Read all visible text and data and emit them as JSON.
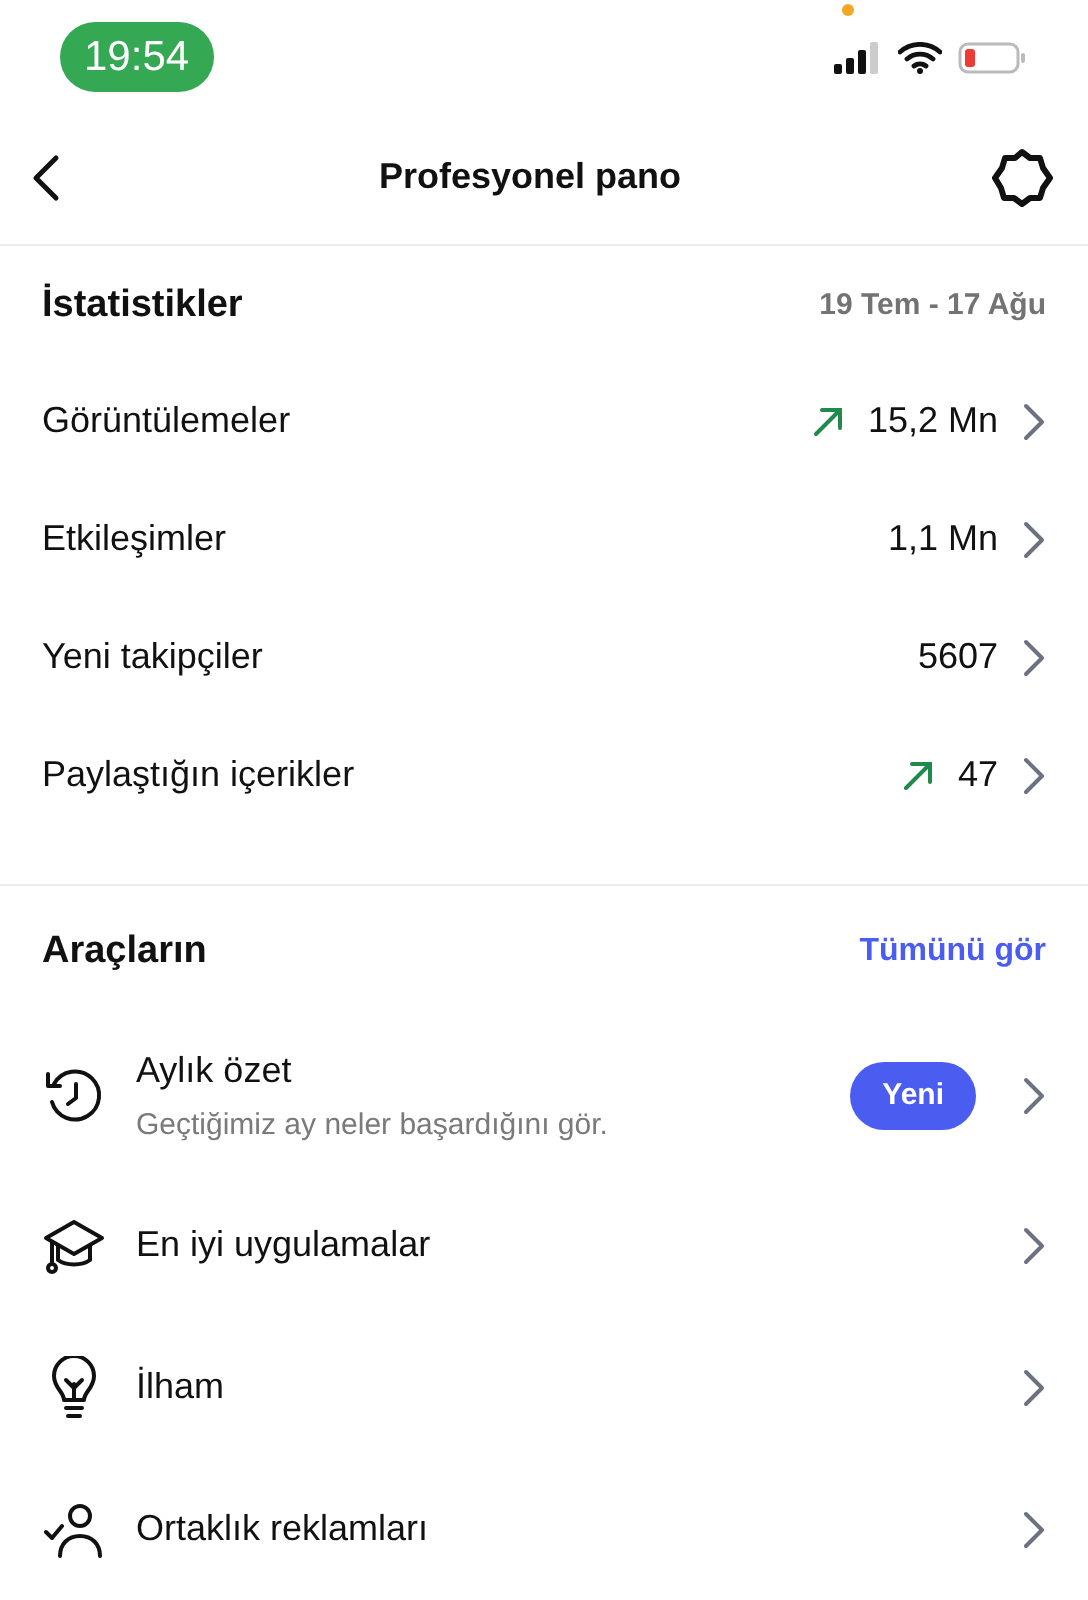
{
  "status_bar": {
    "time": "19:54"
  },
  "header": {
    "title": "Profesyonel pano"
  },
  "stats": {
    "title": "İstatistikler",
    "date_range": "19 Tem - 17 Ağu",
    "rows": [
      {
        "label": "Görüntülemeler",
        "value": "15,2 Mn",
        "trend_up": true
      },
      {
        "label": "Etkileşimler",
        "value": "1,1 Mn",
        "trend_up": false
      },
      {
        "label": "Yeni takipçiler",
        "value": "5607",
        "trend_up": false
      },
      {
        "label": "Paylaştığın içerikler",
        "value": "47",
        "trend_up": true
      }
    ]
  },
  "tools": {
    "title": "Araçların",
    "see_all": "Tümünü gör",
    "items": [
      {
        "kind": "history",
        "label": "Aylık özet",
        "subtitle": "Geçtiğimiz ay neler başardığını gör.",
        "badge": "Yeni"
      },
      {
        "kind": "cap",
        "label": "En iyi uygulamalar"
      },
      {
        "kind": "bulb",
        "label": "İlham"
      },
      {
        "kind": "partner",
        "label": "Ortaklık reklamları"
      }
    ]
  }
}
